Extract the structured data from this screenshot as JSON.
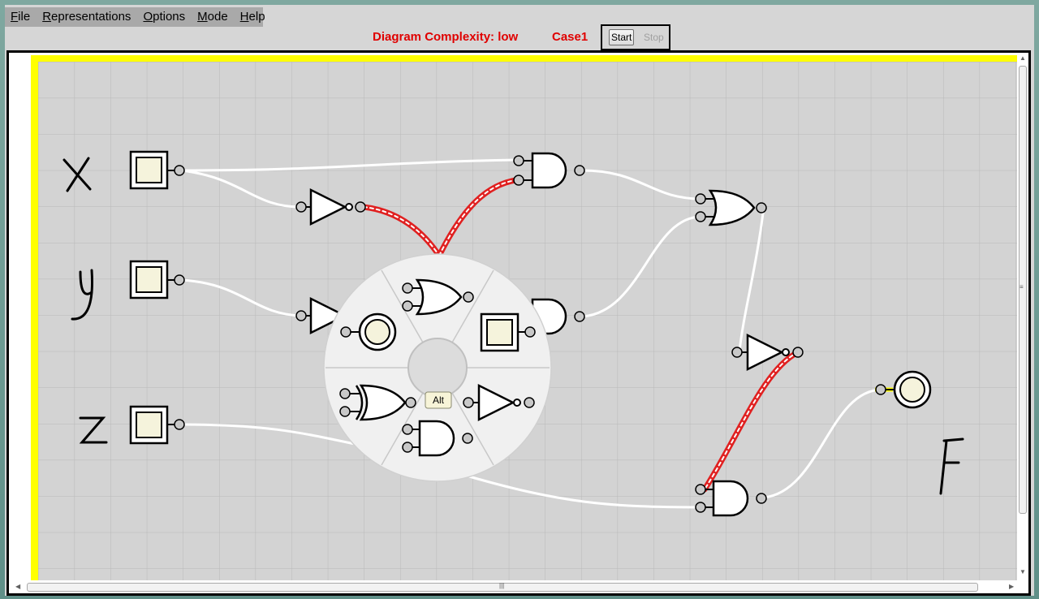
{
  "menu": {
    "file": {
      "mnemonic": "F",
      "rest": "ile"
    },
    "representations": {
      "mnemonic": "R",
      "rest": "epresentations"
    },
    "options": {
      "mnemonic": "O",
      "rest": "ptions"
    },
    "mode": {
      "mnemonic": "M",
      "rest": "ode"
    },
    "help": {
      "mnemonic": "H",
      "rest": "elp"
    }
  },
  "status": {
    "complexity": "Diagram Complexity: low",
    "case": "Case1"
  },
  "controls": {
    "start_label": "Start",
    "stop_label": "Stop"
  },
  "tooltip": {
    "alt_label": "Alt"
  },
  "colors": {
    "status_text": "#e00000",
    "canvas_border": "#ffff00",
    "selected_wire": "#e02020",
    "wire": "#ffffff",
    "grid_bg": "#d3d3d3",
    "io_fill": "#f5f3dc"
  },
  "handwritten_labels": [
    "x",
    "y",
    "z",
    "F"
  ],
  "gate_menu": {
    "items": [
      "or-gate",
      "input-switch",
      "not-gate",
      "and-gate",
      "xor-gate",
      "output-lamp"
    ]
  }
}
